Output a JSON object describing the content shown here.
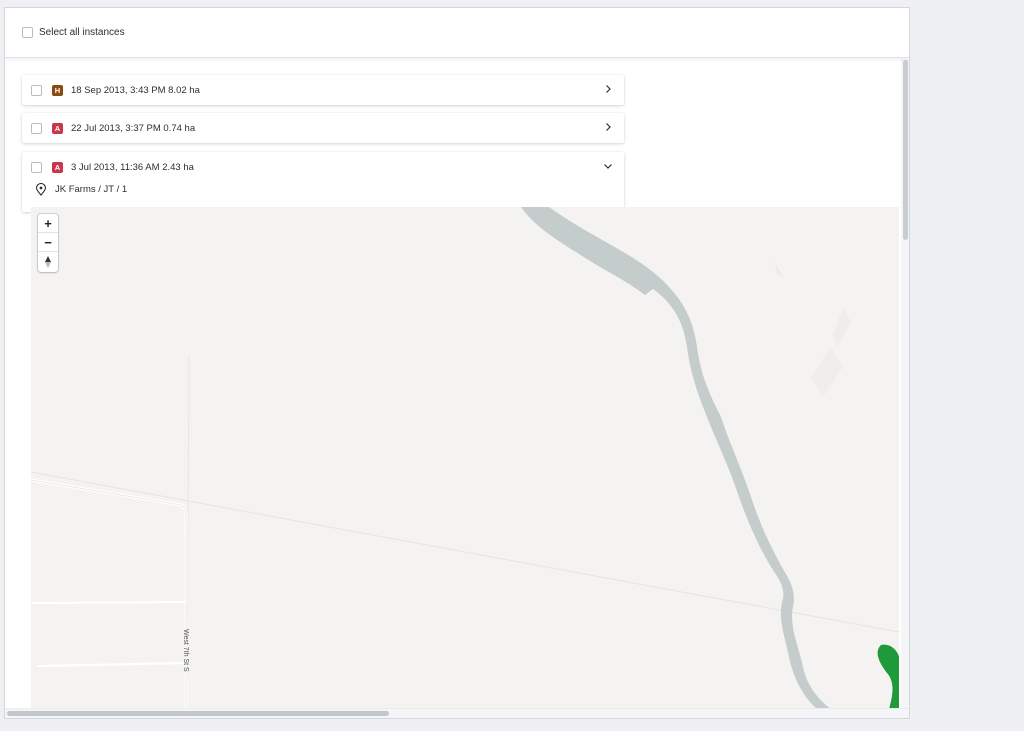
{
  "header": {
    "select_all_label": "Select all instances"
  },
  "instances": [
    {
      "badge": "H",
      "badge_color": "#8a4a12",
      "label": "18 Sep 2013, 3:43 PM 8.02 ha",
      "expanded": false
    },
    {
      "badge": "A",
      "badge_color": "#c8374b",
      "label": "22 Jul 2013, 3:37 PM 0.74 ha",
      "expanded": false
    },
    {
      "badge": "A",
      "badge_color": "#c8374b",
      "label": "3 Jul 2013, 11:36 AM 2.43 ha",
      "expanded": true
    }
  ],
  "expanded_instance": {
    "location": "JK Farms / JT / 1"
  },
  "map": {
    "zoom_in_label": "+",
    "zoom_out_label": "−",
    "compass_label": "▲",
    "road_label": "West 7th St S",
    "colors": {
      "background": "#f4f3f1",
      "river": "#c5cdcc",
      "field": "#1f9a3a",
      "road": "#ffffff"
    }
  },
  "icons": {
    "checkbox": "checkbox-icon",
    "chevron_right": "chevron-right-icon",
    "chevron_down": "chevron-down-icon",
    "location": "location-pin-icon",
    "compass": "compass-icon"
  }
}
